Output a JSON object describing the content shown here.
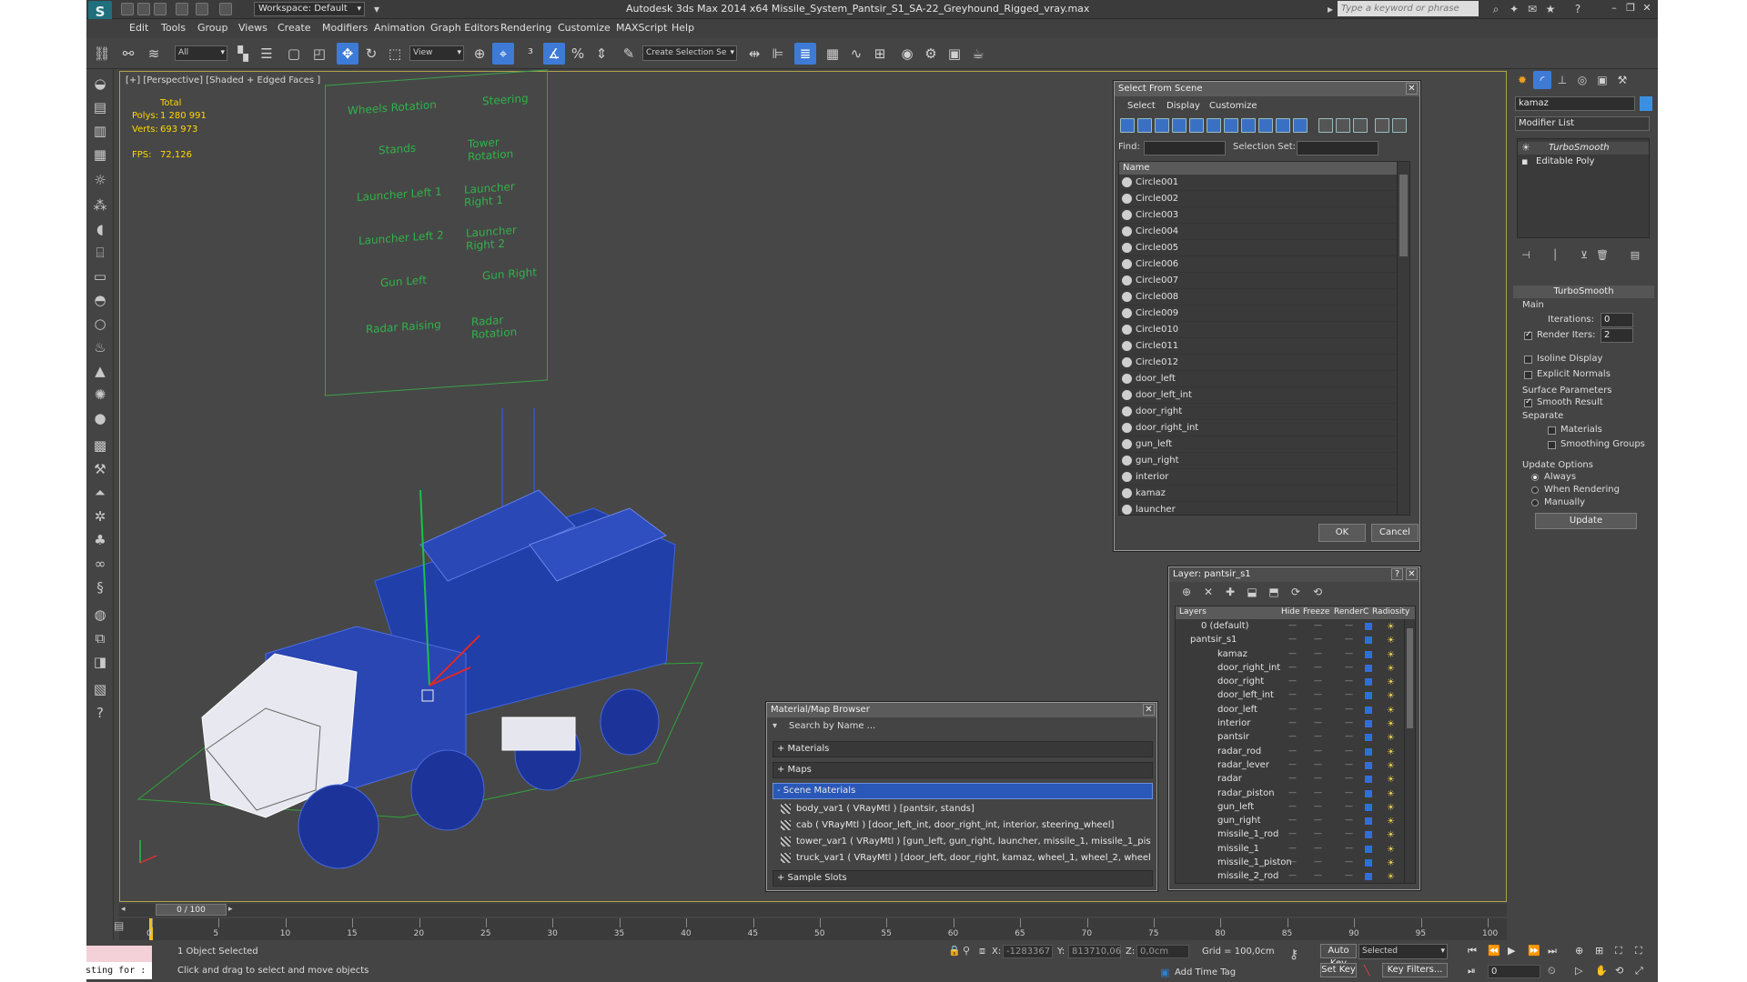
{
  "titlebar": {
    "workspace": "Workspace: Default",
    "title": "Autodesk 3ds Max  2014 x64     Missile_System_Pantsir_S1_SA-22_Greyhound_Rigged_vray.max",
    "search_placeholder": "Type a keyword or phrase"
  },
  "menu": [
    "Edit",
    "Tools",
    "Group",
    "Views",
    "Create",
    "Modifiers",
    "Animation",
    "Graph Editors",
    "Rendering",
    "Customize",
    "MAXScript",
    "Help"
  ],
  "toolbar": {
    "selection_filter": "All",
    "ref_coord": "View",
    "named_selection": "Create Selection Se"
  },
  "viewport": {
    "label": "[+] [Perspective] [Shaded + Edged Faces ]",
    "stats_total": "Total",
    "polys_label": "Polys:",
    "polys_value": "1 280 991",
    "verts_label": "Verts:",
    "verts_value": "693 973",
    "fps_label": "FPS:",
    "fps_value": "72,126",
    "control_labels": [
      "Wheels Rotation",
      "Steering",
      "Stands",
      "Tower Rotation",
      "Launcher Left 1",
      "Launcher Right 1",
      "Launcher Left 2",
      "Launcher Right 2",
      "Gun Left",
      "Gun Right",
      "Radar Raising",
      "Radar Rotation"
    ]
  },
  "select_from_scene": {
    "title": "Select From Scene",
    "tabs": [
      "Select",
      "Display",
      "Customize"
    ],
    "find_label": "Find:",
    "selset_label": "Selection Set:",
    "col_name": "Name",
    "items": [
      "Circle001",
      "Circle002",
      "Circle003",
      "Circle004",
      "Circle005",
      "Circle006",
      "Circle007",
      "Circle008",
      "Circle009",
      "Circle010",
      "Circle011",
      "Circle012",
      "door_left",
      "door_left_int",
      "door_right",
      "door_right_int",
      "gun_left",
      "gun_right",
      "interior",
      "kamaz",
      "launcher"
    ],
    "ok": "OK",
    "cancel": "Cancel"
  },
  "layer_panel": {
    "title": "Layer: pantsir_s1",
    "cols": [
      "Layers",
      "Hide",
      "Freeze",
      "Render",
      "C",
      "Radiosity"
    ],
    "rows": [
      "0 (default)",
      "pantsir_s1",
      "kamaz",
      "door_right_int",
      "door_right",
      "door_left_int",
      "door_left",
      "interior",
      "pantsir",
      "radar_rod",
      "radar_lever",
      "radar",
      "radar_piston",
      "gun_left",
      "gun_right",
      "missile_1_rod",
      "missile_1",
      "missile_1_piston",
      "missile_2_rod"
    ]
  },
  "material_browser": {
    "title": "Material/Map Browser",
    "search": "Search by Name ...",
    "sections": [
      "+ Materials",
      "+ Maps",
      "- Scene Materials"
    ],
    "materials": [
      "body_var1  ( VRayMtl ) [pantsir, stands]",
      "cab  ( VRayMtl ) [door_left_int, door_right_int, interior, steering_wheel]",
      "tower_var1  ( VRayMtl ) [gun_left, gun_right, launcher, missile_1, missile_1_pist...",
      "truck_var1  ( VRayMtl ) [door_left, door_right, kamaz, wheel_1, wheel_2, wheel..."
    ],
    "sample_slots": "+ Sample Slots"
  },
  "command_panel": {
    "object_name": "kamaz",
    "modifier_list": "Modifier List",
    "stack": [
      "TurboSmooth",
      "Editable Poly"
    ],
    "rollout": "TurboSmooth",
    "main": "Main",
    "iterations_label": "Iterations:",
    "iterations_value": "0",
    "render_iters_label": "Render Iters:",
    "render_iters_value": "2",
    "isoline": "Isoline Display",
    "explicit": "Explicit Normals",
    "surface_params": "Surface Parameters",
    "smooth_result": "Smooth Result",
    "separate": "Separate",
    "materials": "Materials",
    "smoothing_groups": "Smoothing Groups",
    "update_options": "Update Options",
    "always": "Always",
    "when_rendering": "When Rendering",
    "manually": "Manually",
    "update_btn": "Update"
  },
  "timeline": {
    "frame": "0 / 100",
    "ticks": [
      "0",
      "5",
      "10",
      "15",
      "20",
      "25",
      "30",
      "35",
      "40",
      "45",
      "50",
      "55",
      "60",
      "65",
      "70",
      "75",
      "80",
      "85",
      "90",
      "95",
      "100"
    ]
  },
  "status": {
    "selected": "1 Object Selected",
    "prompt": "Click and drag to select and move objects",
    "maxscript": "Testing for :",
    "x_label": "X:",
    "x_value": "-1283367",
    "y_label": "Y:",
    "y_value": "813710,06",
    "z_label": "Z:",
    "z_value": "0,0cm",
    "grid": "Grid = 100,0cm",
    "add_time_tag": "Add Time Tag",
    "auto_key": "Auto Key",
    "set_key": "Set Key",
    "selected_dd": "Selected",
    "key_filters": "Key Filters...",
    "frame_field": "0"
  }
}
